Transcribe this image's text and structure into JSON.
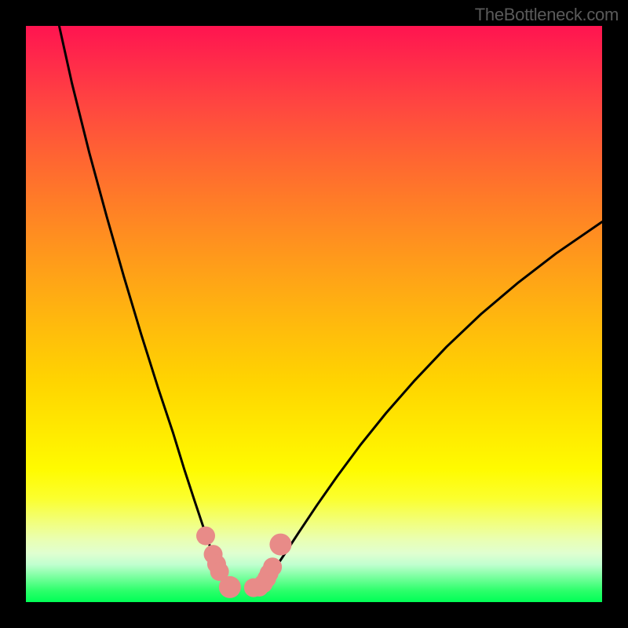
{
  "attribution": "TheBottleneck.com",
  "chart_data": {
    "type": "line",
    "title": "",
    "xlabel": "",
    "ylabel": "",
    "xlim": [
      0,
      100
    ],
    "ylim": [
      0,
      100
    ],
    "grid": false,
    "legend": false,
    "series": [
      {
        "name": "left-branch",
        "x": [
          5.8,
          8,
          11,
          14,
          17,
          20,
          23,
          25.5,
          27.5,
          29.3,
          30.8,
          32,
          33,
          33.8,
          34.5,
          35
        ],
        "values": [
          99.9,
          90,
          78,
          67,
          56.5,
          46.5,
          37,
          29.5,
          23,
          17.5,
          13,
          9.5,
          6.5,
          4.5,
          3.2,
          2.5
        ]
      },
      {
        "name": "right-branch",
        "x": [
          40.5,
          41.5,
          43,
          45,
          47.5,
          50.5,
          54,
          58,
          62.5,
          67.5,
          73,
          79,
          85.5,
          92,
          100
        ],
        "values": [
          2.5,
          3.5,
          5.5,
          8.5,
          12.3,
          16.8,
          21.8,
          27.2,
          32.8,
          38.5,
          44.3,
          50,
          55.5,
          60.5,
          66
        ]
      }
    ],
    "marker_points": {
      "name": "data-markers",
      "x": [
        31.2,
        32.5,
        33.1,
        33.6,
        35.4,
        39.5,
        40.5,
        41.2,
        41.8,
        42.2,
        42.8,
        44.2
      ],
      "values": [
        11.5,
        8.3,
        6.6,
        5.3,
        2.6,
        2.5,
        2.6,
        3.2,
        4.1,
        5.0,
        6.1,
        10.0
      ],
      "color": "#e88b88",
      "size": [
        12,
        12,
        12,
        12,
        14,
        12,
        12,
        12,
        12,
        12,
        12,
        14
      ]
    },
    "gradient_stops": [
      {
        "pos": 0,
        "color": "#ff1450"
      },
      {
        "pos": 50,
        "color": "#ffc800"
      },
      {
        "pos": 80,
        "color": "#fffb00"
      },
      {
        "pos": 100,
        "color": "#00ff56"
      }
    ]
  }
}
